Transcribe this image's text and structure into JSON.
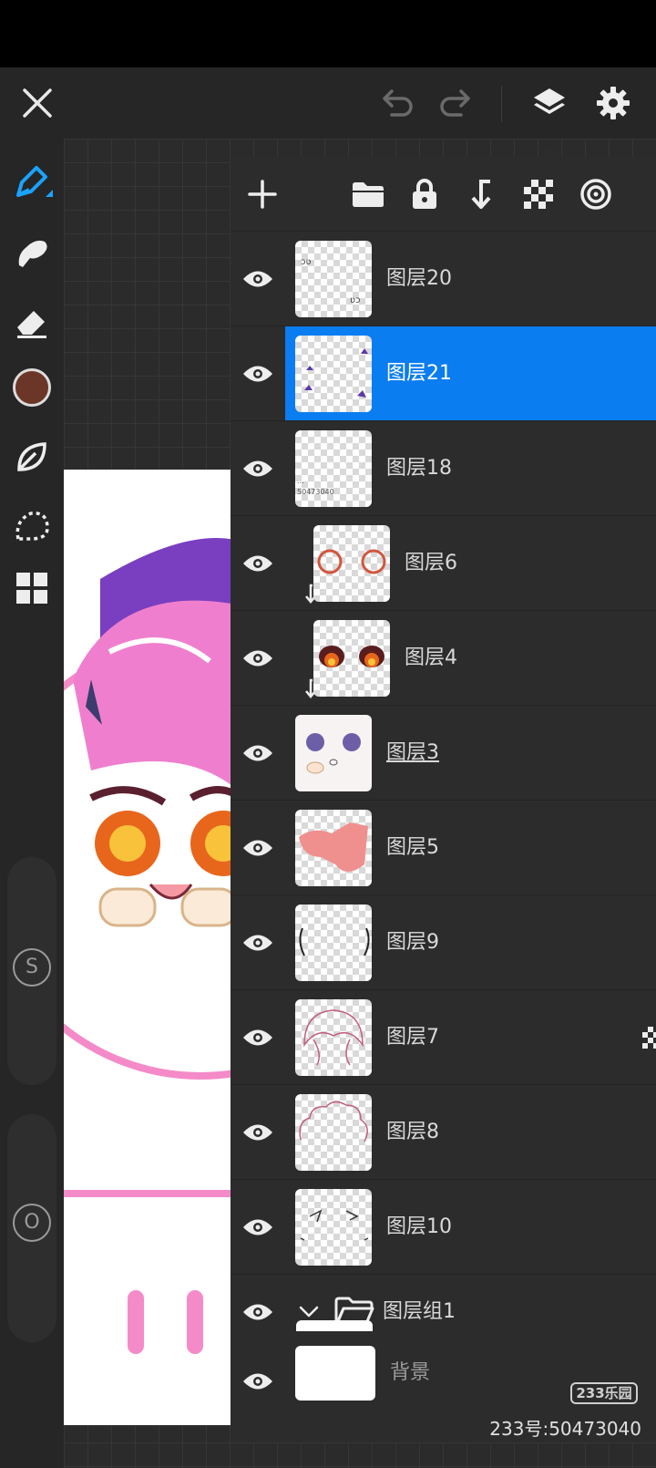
{
  "toolbar": {
    "close": "close",
    "undo": "undo",
    "redo": "redo",
    "layers": "layers",
    "settings": "settings"
  },
  "left_tools": [
    "brush",
    "smudge",
    "eraser",
    "color",
    "leaf",
    "lasso",
    "grid"
  ],
  "colors": {
    "accent": "#0a7df0",
    "active_brush": "#1aa3ff",
    "current_color": "#6b3528",
    "panel_bg": "#2c2c2c"
  },
  "left_sliders": {
    "size_label": "S",
    "opacity_label": "O"
  },
  "layers": [
    {
      "name": "图层20"
    },
    {
      "name": "图层21",
      "selected": true
    },
    {
      "name": "图层18"
    },
    {
      "name": "图层6",
      "clipped": true
    },
    {
      "name": "图层4",
      "clipped": true
    },
    {
      "name": "图层3",
      "underlined": true
    },
    {
      "name": "图层5"
    },
    {
      "name": "图层9"
    },
    {
      "name": "图层7",
      "alpha_lock": true
    },
    {
      "name": "图层8"
    },
    {
      "name": "图层10"
    }
  ],
  "group": {
    "name": "图层组1"
  },
  "background": {
    "name": "背景"
  },
  "watermark": {
    "logo": "233乐园",
    "id": "233号:50473040"
  }
}
